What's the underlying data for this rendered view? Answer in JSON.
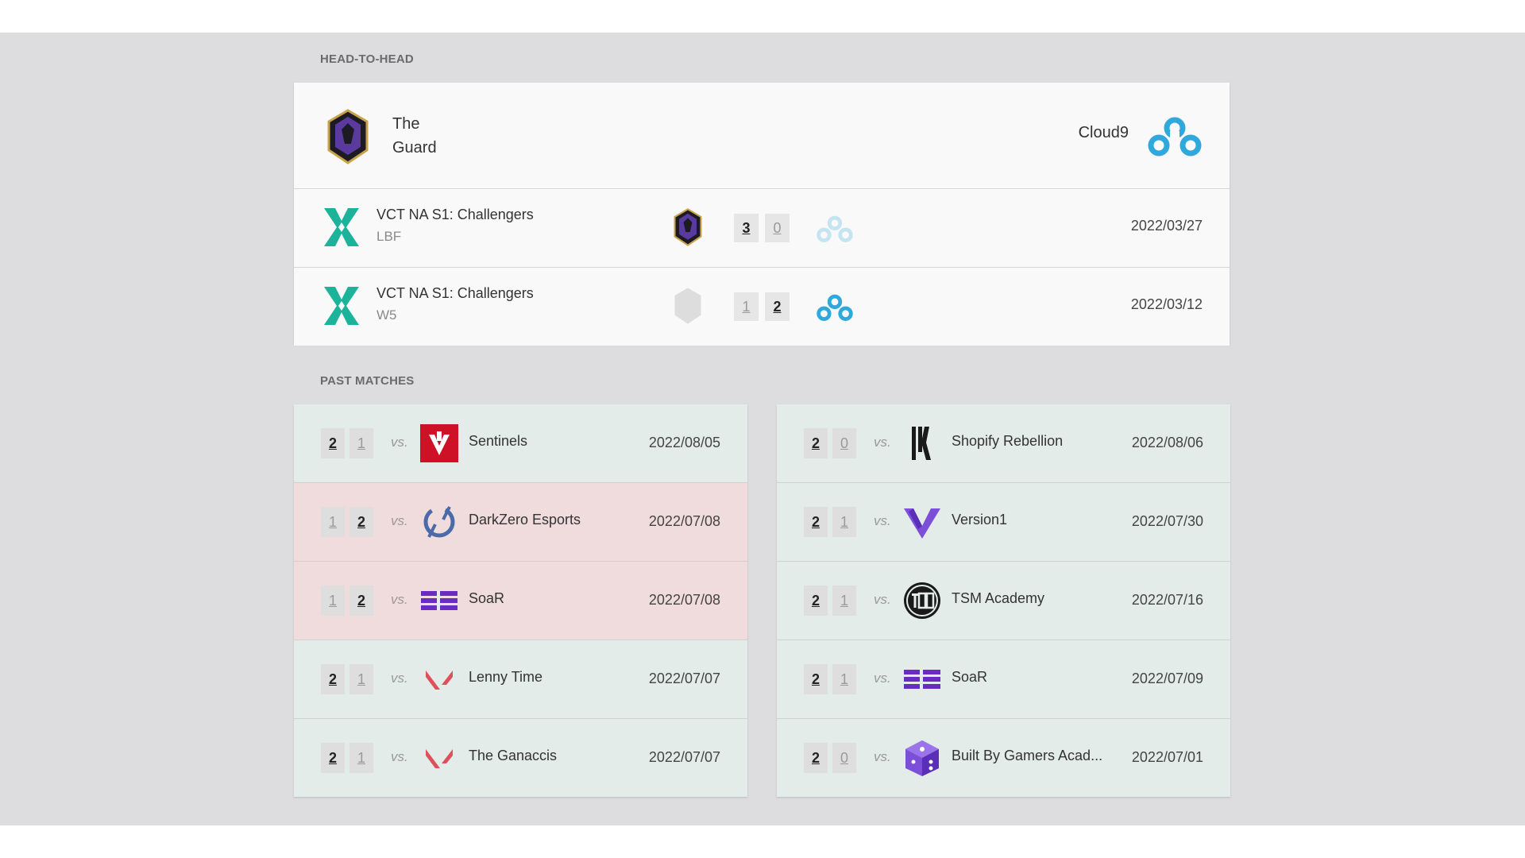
{
  "sections": {
    "head_to_head": "HEAD-TO-HEAD",
    "past_matches": "PAST MATCHES"
  },
  "h2h": {
    "team_left": {
      "name": "The Guard",
      "name_line1": "The",
      "name_line2": "Guard",
      "icon": "the-guard-logo"
    },
    "team_right": {
      "name": "Cloud9",
      "icon": "cloud9-logo"
    },
    "matches": [
      {
        "event": "VCT NA S1: Challengers",
        "stage": "LBF",
        "score_left": "3",
        "score_right": "0",
        "winner": "left",
        "date": "2022/03/27"
      },
      {
        "event": "VCT NA S1: Challengers",
        "stage": "W5",
        "score_left": "1",
        "score_right": "2",
        "winner": "right",
        "date": "2022/03/12"
      }
    ]
  },
  "past_left": [
    {
      "score_a": "2",
      "score_b": "1",
      "result": "win",
      "vs": "vs.",
      "opponent": "Sentinels",
      "icon": "sentinels-logo",
      "date": "2022/08/05"
    },
    {
      "score_a": "1",
      "score_b": "2",
      "result": "loss",
      "vs": "vs.",
      "opponent": "DarkZero Esports",
      "icon": "darkzero-logo",
      "date": "2022/07/08"
    },
    {
      "score_a": "1",
      "score_b": "2",
      "result": "loss",
      "vs": "vs.",
      "opponent": "SoaR",
      "icon": "soar-logo",
      "date": "2022/07/08"
    },
    {
      "score_a": "2",
      "score_b": "1",
      "result": "win",
      "vs": "vs.",
      "opponent": "Lenny Time",
      "icon": "valorant-logo",
      "date": "2022/07/07"
    },
    {
      "score_a": "2",
      "score_b": "1",
      "result": "win",
      "vs": "vs.",
      "opponent": "The Ganaccis",
      "icon": "valorant-logo",
      "date": "2022/07/07"
    }
  ],
  "past_right": [
    {
      "score_a": "2",
      "score_b": "0",
      "result": "win",
      "vs": "vs.",
      "opponent": "Shopify Rebellion",
      "icon": "shopify-rebellion-logo",
      "date": "2022/08/06"
    },
    {
      "score_a": "2",
      "score_b": "1",
      "result": "win",
      "vs": "vs.",
      "opponent": "Version1",
      "icon": "version1-logo",
      "date": "2022/07/30"
    },
    {
      "score_a": "2",
      "score_b": "1",
      "result": "win",
      "vs": "vs.",
      "opponent": "TSM Academy",
      "icon": "tsm-logo",
      "date": "2022/07/16"
    },
    {
      "score_a": "2",
      "score_b": "1",
      "result": "win",
      "vs": "vs.",
      "opponent": "SoaR",
      "icon": "soar-logo",
      "date": "2022/07/09"
    },
    {
      "score_a": "2",
      "score_b": "0",
      "result": "win",
      "vs": "vs.",
      "opponent": "Built By Gamers Acad...",
      "icon": "built-by-gamers-logo",
      "date": "2022/07/01"
    }
  ],
  "colors": {
    "background": "#dddddf",
    "card": "#f9f9f9",
    "win_row": "#e3ece8",
    "loss_row": "#f0dcdc",
    "vct_teal": "#1db39a",
    "cloud9_blue": "#2fa8dc",
    "guard_purple": "#5b3aa0",
    "sentinels_red": "#ce1126",
    "soar_purple": "#6a2bc2",
    "valorant_red": "#e0505a"
  }
}
